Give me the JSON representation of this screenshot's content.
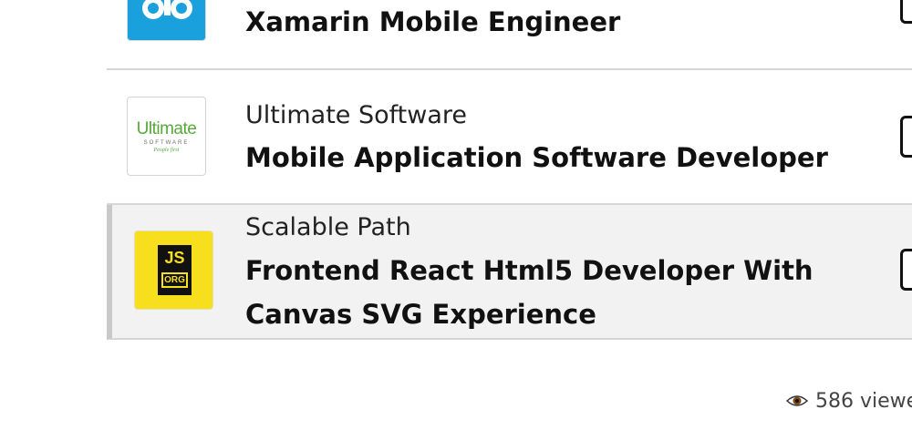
{
  "jobs": [
    {
      "company": "",
      "title": "Xamarin Mobile Engineer",
      "logo_color": "#1aa0dc",
      "logo_icon": "briefcase-ojo-logo"
    },
    {
      "company": "Ultimate Software",
      "title": "Mobile Application Software Developer",
      "logo_text": "Ultimate",
      "logo_sub": "SOFTWARE",
      "logo_tag": "People first",
      "logo_color": "#58a83a"
    },
    {
      "company": "Scalable Path",
      "title": "Frontend React Html5 Developer With Canvas SVG Experience",
      "logo_text": "JS",
      "logo_sub": "ORG",
      "logo_color": "#f7df1e",
      "highlighted": true
    }
  ],
  "footer": {
    "views_text": "586 viewe",
    "icon": "eye-icon"
  }
}
